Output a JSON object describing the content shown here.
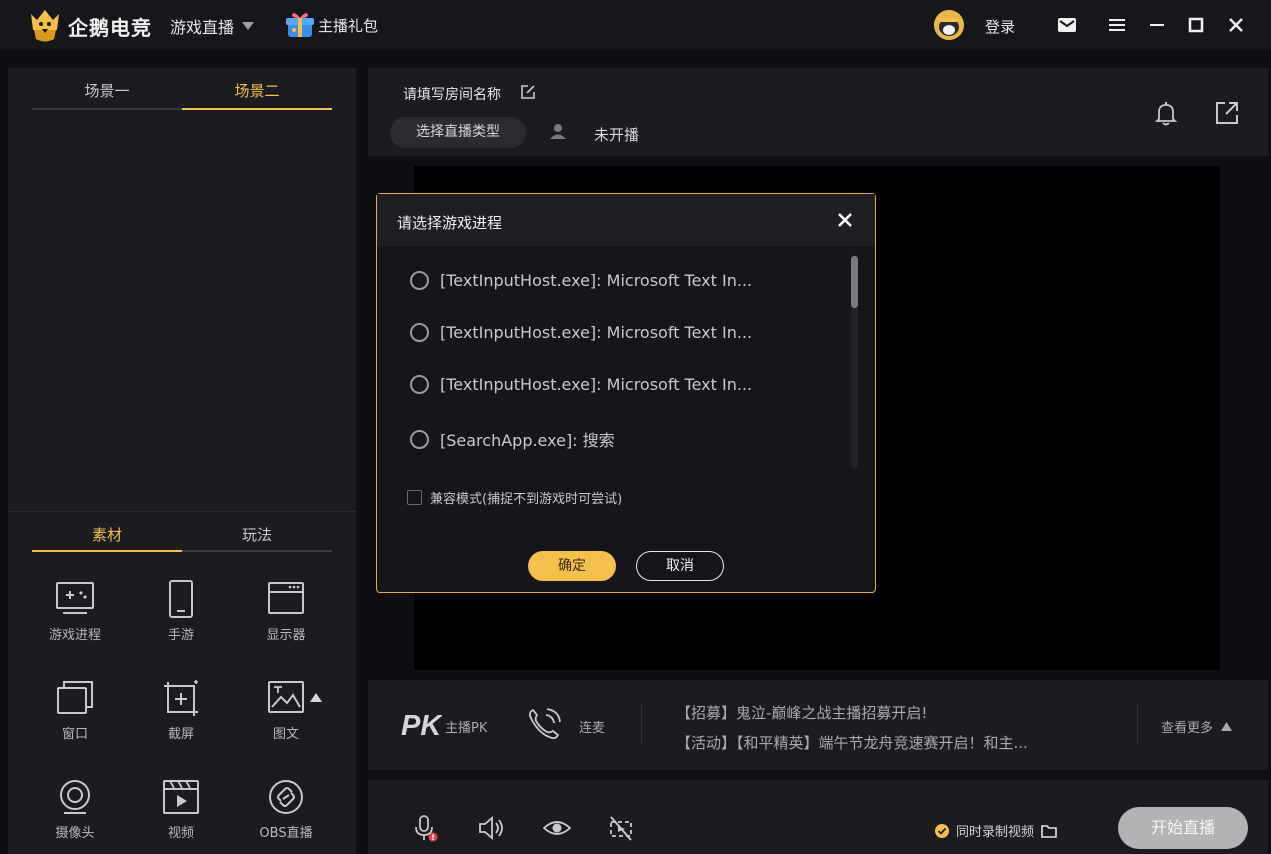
{
  "app": {
    "name": "企鹅电竞",
    "menu_live": "游戏直播",
    "gift_label": "主播礼包",
    "login": "登录"
  },
  "scenes": {
    "tabs": [
      "场景一",
      "场景二"
    ],
    "active": 1
  },
  "materials": {
    "tabs": [
      "素材",
      "玩法"
    ],
    "active": 0,
    "tools": [
      "游戏进程",
      "手游",
      "显示器",
      "窗口",
      "截屏",
      "图文",
      "摄像头",
      "视频",
      "OBS直播"
    ]
  },
  "room": {
    "name_placeholder": "请填写房间名称",
    "type_button": "选择直播类型",
    "status": "未开播"
  },
  "pk": {
    "logo": "PK",
    "label": "主播PK",
    "link_label": "连麦",
    "news": [
      "【招募】鬼泣-巅峰之战主播招募开启!",
      "【活动】【和平精英】端午节龙舟竞速赛开启！和主..."
    ],
    "more": "查看更多"
  },
  "bottom": {
    "record_label": "同时录制视频",
    "start_button": "开始直播"
  },
  "dialog": {
    "title": "请选择游戏进程",
    "processes": [
      "[TextInputHost.exe]: Microsoft Text In...",
      "[TextInputHost.exe]: Microsoft Text In...",
      "[TextInputHost.exe]: Microsoft Text In...",
      "[SearchApp.exe]: 搜索"
    ],
    "compat_mode": "兼容模式(捕捉不到游戏时可尝试)",
    "ok": "确定",
    "cancel": "取消"
  },
  "colors": {
    "accent": "#f3c14b",
    "panel": "#1b1b20",
    "background": "#0f0f13"
  }
}
